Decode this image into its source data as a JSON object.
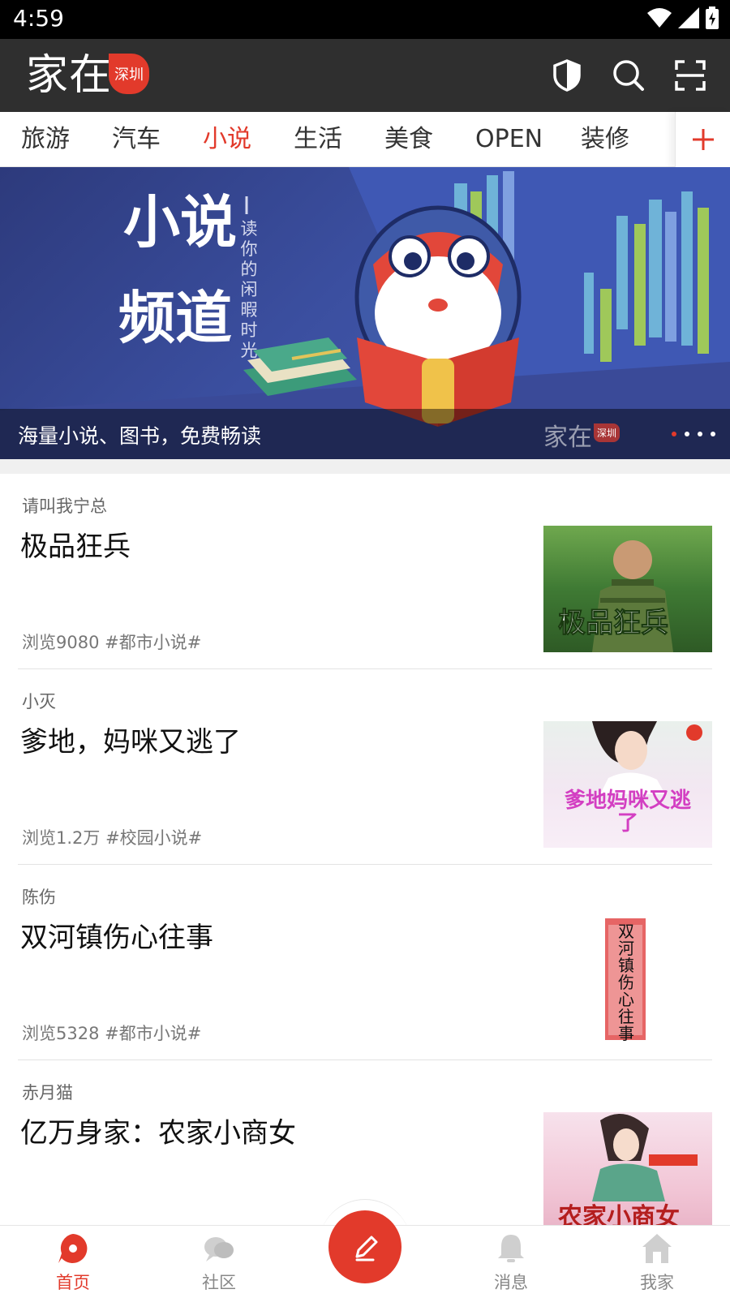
{
  "status_bar": {
    "time": "4:59"
  },
  "header": {
    "logo_text": "家在",
    "city_badge": "深圳"
  },
  "tabs": [
    {
      "label": "旅游"
    },
    {
      "label": "汽车"
    },
    {
      "label": "小说",
      "active": true
    },
    {
      "label": "生活"
    },
    {
      "label": "美食"
    },
    {
      "label": "OPEN"
    },
    {
      "label": "装修"
    }
  ],
  "banner": {
    "title_line1": "小说",
    "title_line2": "频道",
    "subtitle": "读你的闲暇时光",
    "caption": "海量小说、图书，免费畅读",
    "watermark": "家在",
    "watermark_badge": "深圳",
    "slide_count": 4,
    "active_slide": 1
  },
  "feed": [
    {
      "author": "请叫我宁总",
      "title": "极品狂兵",
      "meta": "浏览9080  #都市小说#",
      "cover_text": "极品狂兵"
    },
    {
      "author": "小灭",
      "title": "爹地，妈咪又逃了",
      "meta": "浏览1.2万  #校园小说#",
      "cover_text": "爹地妈咪又逃了"
    },
    {
      "author": "陈伤",
      "title": "双河镇伤心往事",
      "meta": "浏览5328  #都市小说#",
      "cover_text": "双河镇伤心往事"
    },
    {
      "author": "赤月猫",
      "title": "亿万身家：农家小商女",
      "meta": "",
      "cover_text": "农家小商女"
    }
  ],
  "bottom_nav": [
    {
      "label": "首页",
      "icon": "home-chat-icon",
      "active": true
    },
    {
      "label": "社区",
      "icon": "community-icon"
    },
    {
      "label": "消息",
      "icon": "bell-icon"
    },
    {
      "label": "我家",
      "icon": "house-icon"
    }
  ],
  "colors": {
    "accent": "#e23a2b",
    "header_bg": "#2f2f2f",
    "status_bg": "#000000"
  }
}
